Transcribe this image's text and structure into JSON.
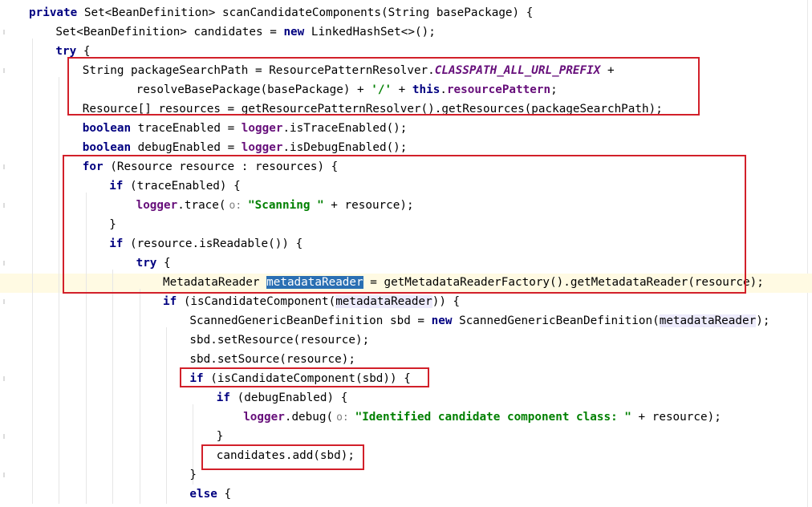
{
  "editor": {
    "lines": [
      {
        "indent": 0,
        "tokens": [
          {
            "t": "private ",
            "c": "kw"
          },
          {
            "t": "Set<BeanDefinition> scanCandidateComponents(String basePackage) {"
          }
        ]
      },
      {
        "indent": 1,
        "tokens": [
          {
            "t": "Set<BeanDefinition> candidates = "
          },
          {
            "t": "new ",
            "c": "kw"
          },
          {
            "t": "LinkedHashSet<>();"
          }
        ]
      },
      {
        "indent": 1,
        "tokens": [
          {
            "t": "try ",
            "c": "kw"
          },
          {
            "t": "{"
          }
        ]
      },
      {
        "indent": 2,
        "tokens": [
          {
            "t": "String packageSearchPath = ResourcePatternResolver."
          },
          {
            "t": "CLASSPATH_ALL_URL_PREFIX",
            "c": "const"
          },
          {
            "t": " +"
          }
        ]
      },
      {
        "indent": 4,
        "tokens": [
          {
            "t": "resolveBasePackage(basePackage) + "
          },
          {
            "t": "'/'",
            "c": "str"
          },
          {
            "t": " + "
          },
          {
            "t": "this",
            "c": "kw"
          },
          {
            "t": "."
          },
          {
            "t": "resourcePattern",
            "c": "field"
          },
          {
            "t": ";"
          }
        ]
      },
      {
        "indent": 2,
        "tokens": [
          {
            "t": "Resource[] resources = getResourcePatternResolver().getResources(packageSearchPath);"
          }
        ]
      },
      {
        "indent": 2,
        "tokens": [
          {
            "t": "boolean ",
            "c": "kw"
          },
          {
            "t": "traceEnabled = "
          },
          {
            "t": "logger",
            "c": "field"
          },
          {
            "t": ".isTraceEnabled();"
          }
        ]
      },
      {
        "indent": 2,
        "tokens": [
          {
            "t": "boolean ",
            "c": "kw"
          },
          {
            "t": "debugEnabled = "
          },
          {
            "t": "logger",
            "c": "field"
          },
          {
            "t": ".isDebugEnabled();"
          }
        ]
      },
      {
        "indent": 2,
        "tokens": [
          {
            "t": "for ",
            "c": "kw"
          },
          {
            "t": "(Resource resource : resources) {"
          }
        ]
      },
      {
        "indent": 3,
        "tokens": [
          {
            "t": "if ",
            "c": "kw"
          },
          {
            "t": "(traceEnabled) {"
          }
        ]
      },
      {
        "indent": 4,
        "tokens": [
          {
            "t": "logger",
            "c": "field"
          },
          {
            "t": ".trace("
          },
          {
            "t": "o: ",
            "c": "hint"
          },
          {
            "t": "\"Scanning \"",
            "c": "str"
          },
          {
            "t": " + resource);"
          }
        ]
      },
      {
        "indent": 3,
        "tokens": [
          {
            "t": "}"
          }
        ]
      },
      {
        "indent": 3,
        "tokens": [
          {
            "t": "if ",
            "c": "kw"
          },
          {
            "t": "(resource.isReadable()) {"
          }
        ]
      },
      {
        "indent": 4,
        "tokens": [
          {
            "t": "try ",
            "c": "kw"
          },
          {
            "t": "{"
          }
        ]
      },
      {
        "indent": 5,
        "tokens": [
          {
            "t": "MetadataReader "
          },
          {
            "t": "metadataReader",
            "c": "sel"
          },
          {
            "t": " = getMetadataReaderFactory().getMetadataReader(resource);"
          }
        ]
      },
      {
        "indent": 5,
        "tokens": [
          {
            "t": "if ",
            "c": "kw"
          },
          {
            "t": "(isCandidateComponent("
          },
          {
            "t": "metadataReader",
            "c": "usage"
          },
          {
            "t": ")) {"
          }
        ]
      },
      {
        "indent": 6,
        "tokens": [
          {
            "t": "ScannedGenericBeanDefinition sbd = "
          },
          {
            "t": "new ",
            "c": "kw"
          },
          {
            "t": "ScannedGenericBeanDefinition("
          },
          {
            "t": "metadataReader",
            "c": "usage"
          },
          {
            "t": ");"
          }
        ]
      },
      {
        "indent": 6,
        "tokens": [
          {
            "t": "sbd.setResource(resource);"
          }
        ]
      },
      {
        "indent": 6,
        "tokens": [
          {
            "t": "sbd.setSource(resource);"
          }
        ]
      },
      {
        "indent": 6,
        "tokens": [
          {
            "t": "if ",
            "c": "kw"
          },
          {
            "t": "(isCandidateComponent(sbd)) {"
          }
        ]
      },
      {
        "indent": 7,
        "tokens": [
          {
            "t": "if ",
            "c": "kw"
          },
          {
            "t": "(debugEnabled) {"
          }
        ]
      },
      {
        "indent": 8,
        "tokens": [
          {
            "t": "logger",
            "c": "field"
          },
          {
            "t": ".debug("
          },
          {
            "t": "o: ",
            "c": "hint"
          },
          {
            "t": "\"Identified candidate component class: \"",
            "c": "str"
          },
          {
            "t": " + resource);"
          }
        ]
      },
      {
        "indent": 7,
        "tokens": [
          {
            "t": "}"
          }
        ]
      },
      {
        "indent": 7,
        "tokens": [
          {
            "t": "candidates.add(sbd);"
          }
        ]
      },
      {
        "indent": 6,
        "tokens": [
          {
            "t": "}"
          }
        ]
      },
      {
        "indent": 6,
        "tokens": [
          {
            "t": "else ",
            "c": "kw"
          },
          {
            "t": "{"
          }
        ]
      }
    ]
  },
  "colors": {
    "highlight_box": "#d2202a",
    "keyword": "#000080",
    "field": "#660e7a",
    "string": "#008000",
    "selection": "#2a6fb3",
    "caret_line": "#fffae3"
  }
}
